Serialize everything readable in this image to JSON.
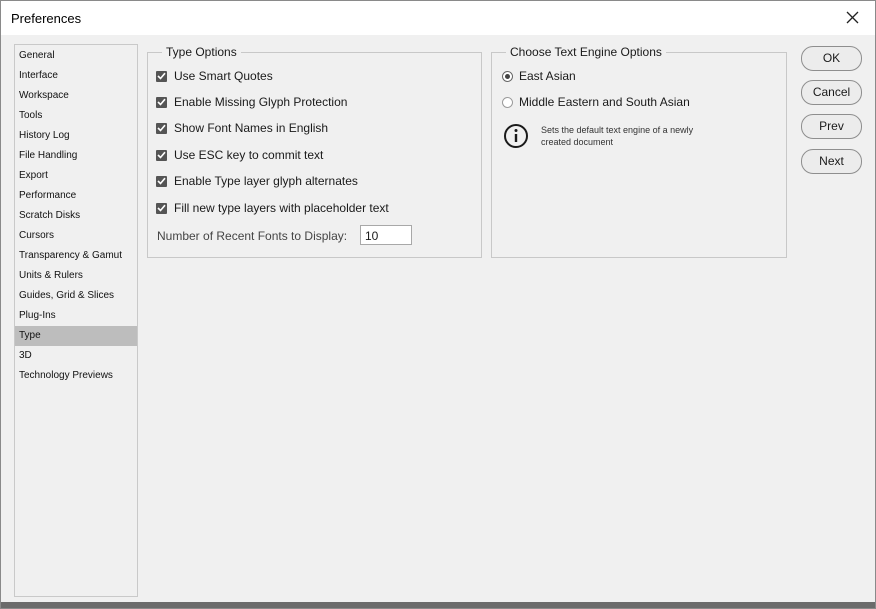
{
  "window": {
    "title": "Preferences"
  },
  "sidebar": {
    "items": [
      {
        "label": "General"
      },
      {
        "label": "Interface"
      },
      {
        "label": "Workspace"
      },
      {
        "label": "Tools"
      },
      {
        "label": "History Log"
      },
      {
        "label": "File Handling"
      },
      {
        "label": "Export"
      },
      {
        "label": "Performance"
      },
      {
        "label": "Scratch Disks"
      },
      {
        "label": "Cursors"
      },
      {
        "label": "Transparency & Gamut"
      },
      {
        "label": "Units & Rulers"
      },
      {
        "label": "Guides, Grid & Slices"
      },
      {
        "label": "Plug-Ins"
      },
      {
        "label": "Type"
      },
      {
        "label": "3D"
      },
      {
        "label": "Technology Previews"
      }
    ],
    "selected": "Type"
  },
  "type_options": {
    "legend": "Type Options",
    "checkboxes": [
      {
        "label": "Use Smart Quotes",
        "checked": true
      },
      {
        "label": "Enable Missing Glyph Protection",
        "checked": true
      },
      {
        "label": "Show Font Names in English",
        "checked": true
      },
      {
        "label": "Use ESC key to commit text",
        "checked": true
      },
      {
        "label": "Enable Type layer glyph alternates",
        "checked": true
      },
      {
        "label": "Fill new type layers with placeholder text",
        "checked": true
      }
    ],
    "recent_fonts_label": "Number of Recent Fonts to Display:",
    "recent_fonts_value": "10"
  },
  "text_engine": {
    "legend": "Choose Text Engine Options",
    "options": [
      {
        "label": "East Asian",
        "selected": true
      },
      {
        "label": "Middle Eastern and South Asian",
        "selected": false
      }
    ],
    "info_line1": "Sets the default text engine of a newly",
    "info_line2": "created document"
  },
  "buttons": {
    "ok": "OK",
    "cancel": "Cancel",
    "prev": "Prev",
    "next": "Next"
  },
  "icons": {
    "close": "close-icon",
    "info": "info-icon",
    "check": "checkmark-icon"
  }
}
